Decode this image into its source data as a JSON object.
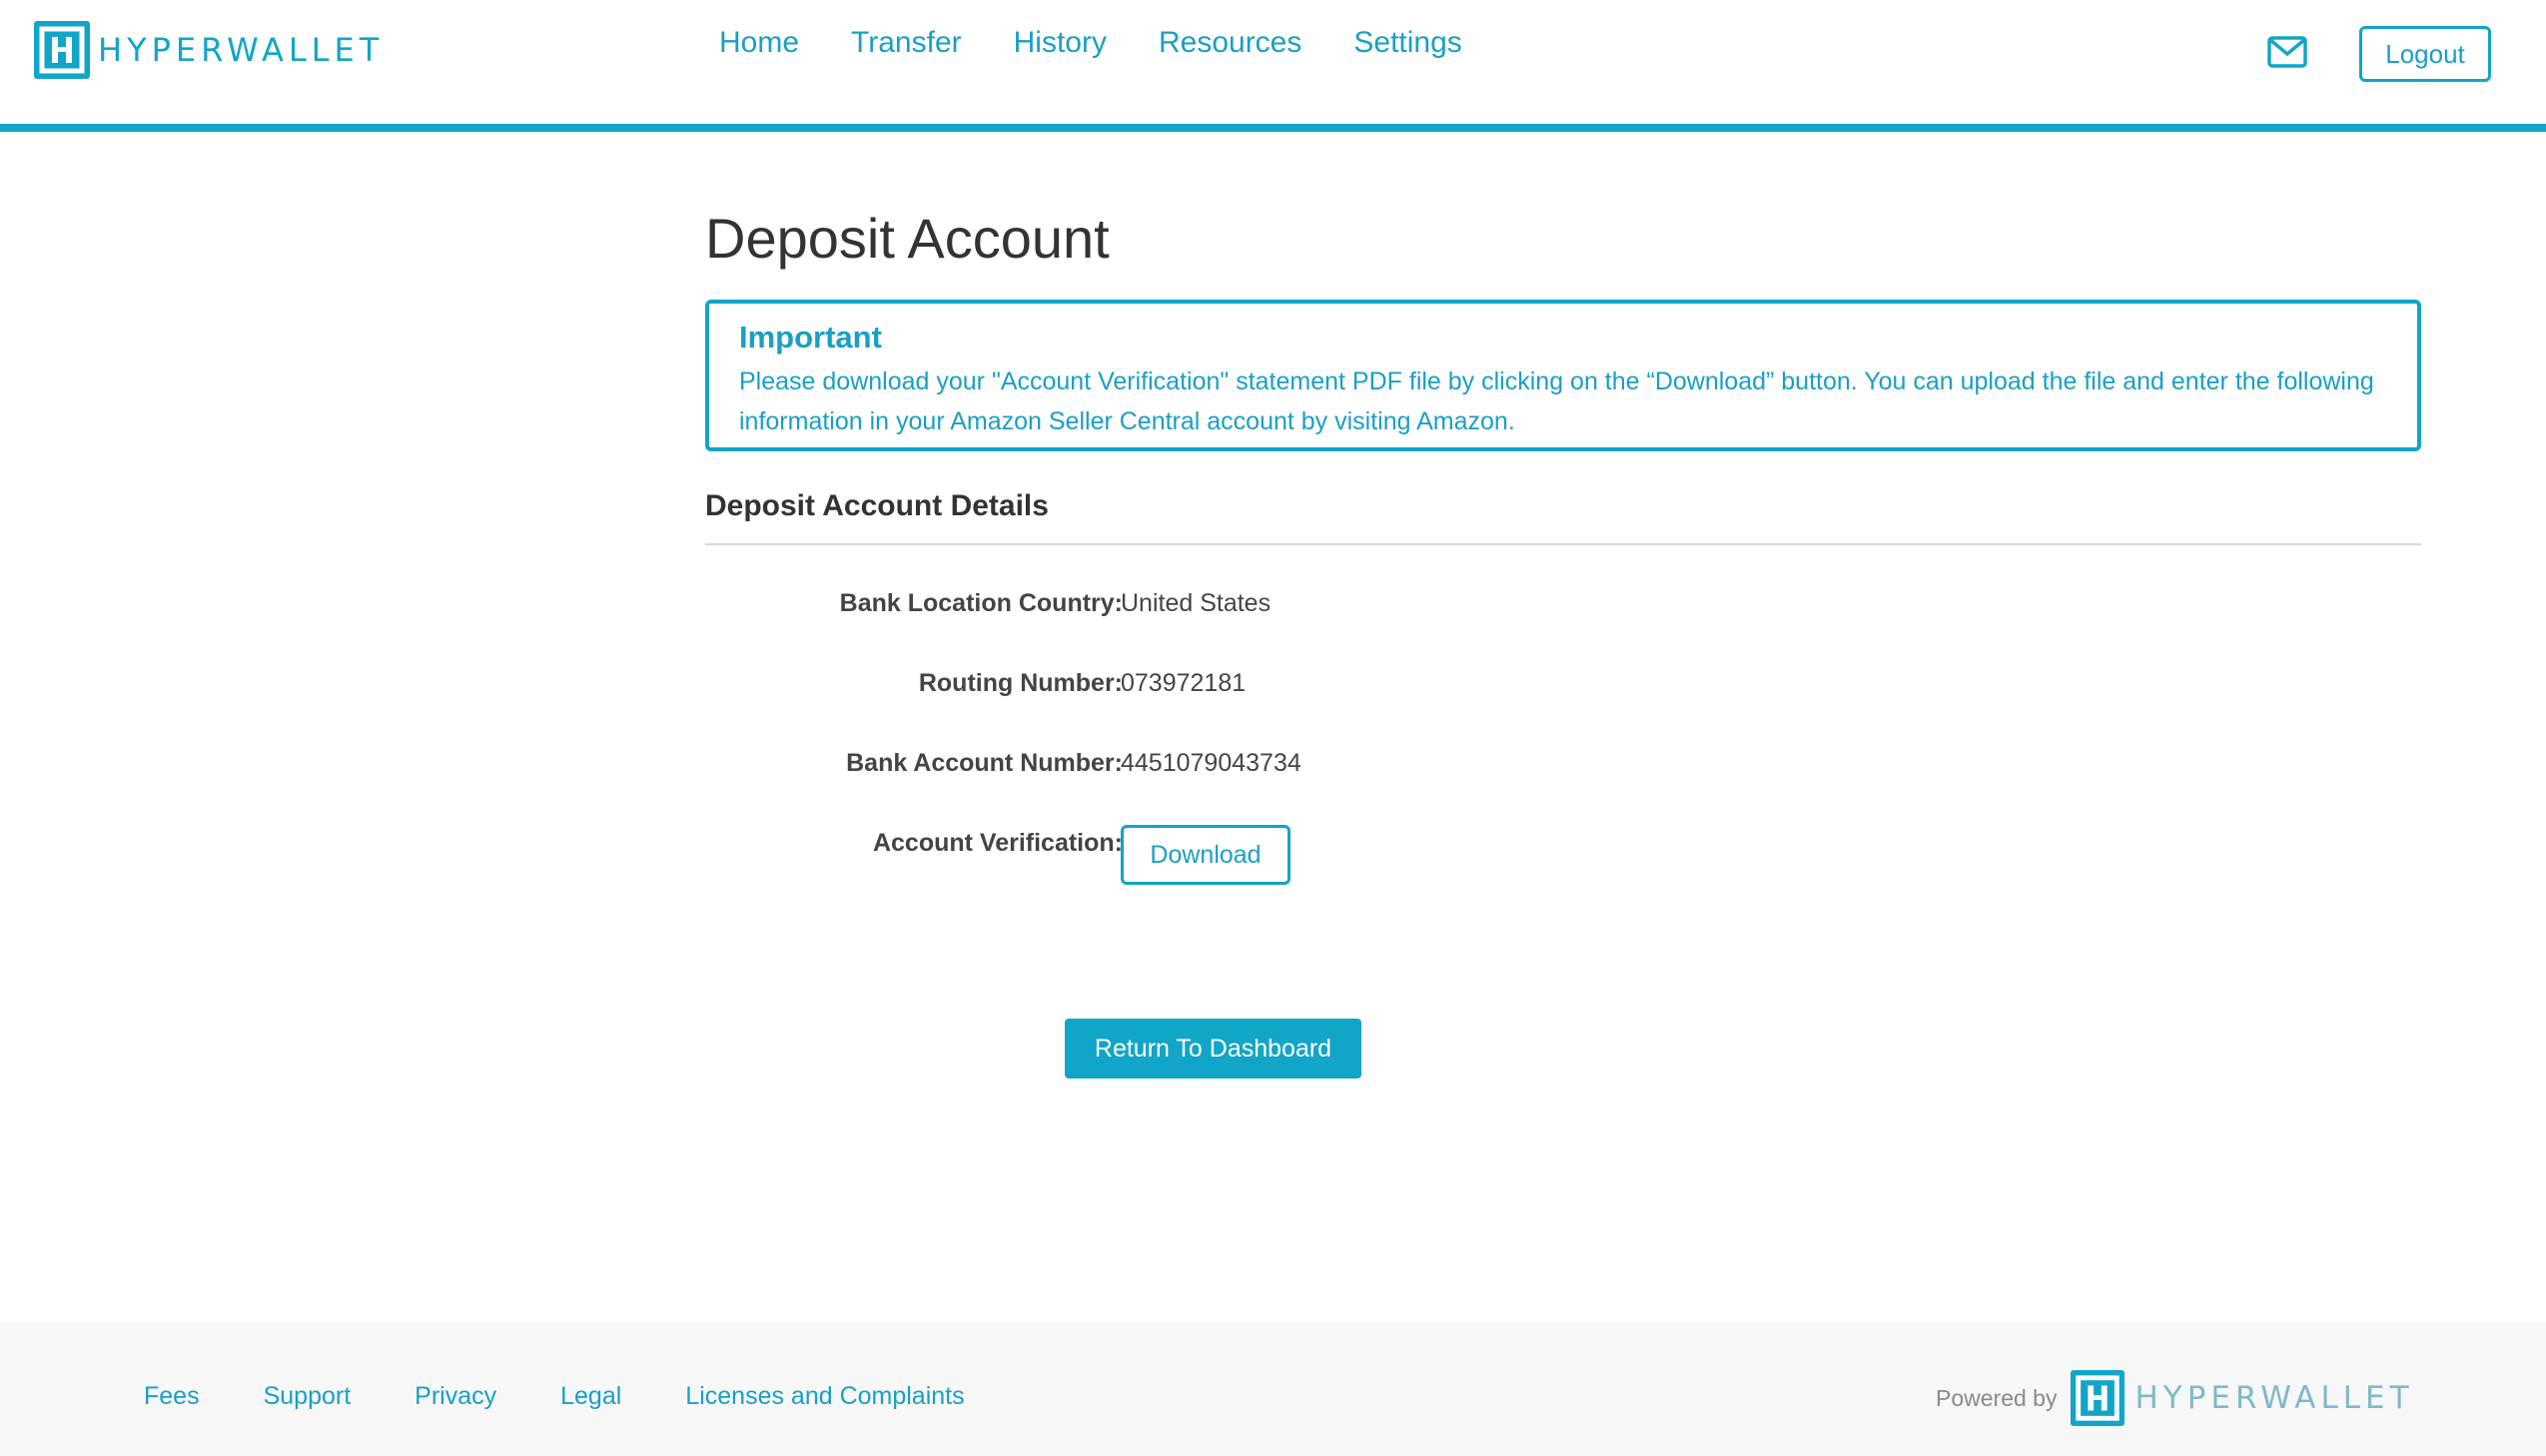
{
  "header": {
    "brand": "HYPERWALLET",
    "nav": [
      {
        "label": "Home"
      },
      {
        "label": "Transfer"
      },
      {
        "label": "History"
      },
      {
        "label": "Resources"
      },
      {
        "label": "Settings"
      }
    ],
    "mail_icon": "mail-icon",
    "logout_label": "Logout"
  },
  "main": {
    "title": "Deposit Account",
    "notice": {
      "title": "Important",
      "body": "Please download your \"Account Verification\" statement PDF file by clicking on the “Download” button. You can upload the file and enter the following information in your Amazon Seller Central account by visiting Amazon."
    },
    "section_title": "Deposit Account Details",
    "details": [
      {
        "label": "Bank Location Country:",
        "value": "United States"
      },
      {
        "label": "Routing Number:",
        "value": "073972181"
      },
      {
        "label": "Bank Account Number:",
        "value": "4451079043734"
      },
      {
        "label": "Account Verification:",
        "value": ""
      }
    ],
    "download_label": "Download",
    "dashboard_label": "Return To Dashboard"
  },
  "footer": {
    "links": [
      {
        "label": "Fees"
      },
      {
        "label": "Support"
      },
      {
        "label": "Privacy"
      },
      {
        "label": "Legal"
      },
      {
        "label": "Licenses and Complaints"
      }
    ],
    "powered_by": "Powered by",
    "brand": "HYPERWALLET"
  },
  "colors": {
    "accent": "#11a5c7",
    "link": "#1a9fc4",
    "text": "#333333",
    "footer_bg": "#f7f7f7"
  }
}
